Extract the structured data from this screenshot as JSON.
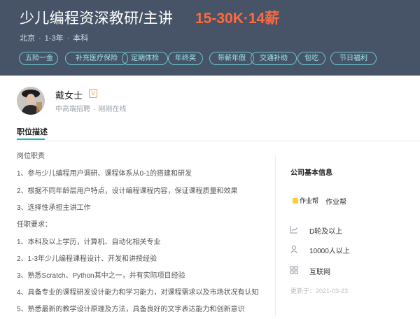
{
  "job": {
    "title": "少儿编程资深教研/主讲",
    "salary": "15-30K·14薪",
    "city": "北京",
    "experience": "1-3年",
    "education": "本科",
    "benefits": [
      "五险一金",
      "补充医疗保险",
      "定期体检",
      "年终奖",
      "带薪年假",
      "交通补助",
      "包吃",
      "节日福利"
    ]
  },
  "recruiter": {
    "name": "戴女士",
    "badge": "V",
    "role": "中高端招聘",
    "status": "刚刚在线"
  },
  "description": {
    "section_title": "职位描述",
    "lines": [
      "岗位职责",
      "1、参与少儿编程用户调研、课程体系从0-1的搭建和研发",
      "2、根据不同年龄层用户特点，设计编程课程内容，保证课程质量和效果",
      "3、选择性承担主讲工作",
      "任职要求：",
      "1、本科及以上学历，计算机、自动化相关专业",
      "2、1-3年少儿编程课程设计、开发和讲授经验",
      "3、熟悉Scratch、Python其中之一，并有实际项目经验",
      "4、具备专业的课程研发设计能力和学习能力，对课程需求以及市场状况有认知",
      "5、熟悉最新的教学设计原理及方法，具备良好的文字表达能力和创新意识"
    ]
  },
  "company": {
    "header": "公司基本信息",
    "logo_text": "作业帮",
    "name": "作业帮",
    "funding": "D轮及以上",
    "size": "10000人以上",
    "industry": "互联网",
    "updated": "更新于：2021-03-23"
  },
  "colors": {
    "banner": "#475468",
    "salary": "#ff6a3d",
    "tag_border": "#69c5cf",
    "accent": "#24b4be"
  }
}
